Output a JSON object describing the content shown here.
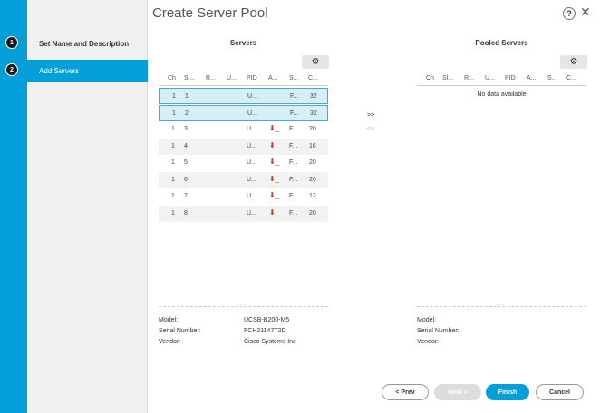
{
  "title": "Create Server Pool",
  "help_label": "?",
  "close_label": "✕",
  "steps": [
    {
      "num": "1",
      "label": "Set Name and Description"
    },
    {
      "num": "2",
      "label": "Add Servers"
    }
  ],
  "servers_panel": {
    "title": "Servers",
    "gear_icon": "⚙",
    "columns": [
      "Ch",
      "Sl...",
      "R...",
      "U...",
      "PID",
      "A...",
      "S...",
      "C..."
    ],
    "rows": [
      {
        "ch": "1",
        "slot": "1",
        "pid": "U...",
        "status": "",
        "s": "F...",
        "c": "32",
        "selected": true
      },
      {
        "ch": "1",
        "slot": "2",
        "pid": "U...",
        "status": "",
        "s": "F...",
        "c": "32",
        "selected": true
      },
      {
        "ch": "1",
        "slot": "3",
        "pid": "U...",
        "status": "⬇_",
        "s": "F...",
        "c": "20",
        "selected": false
      },
      {
        "ch": "1",
        "slot": "4",
        "pid": "U...",
        "status": "⬇_",
        "s": "F...",
        "c": "16",
        "selected": false
      },
      {
        "ch": "1",
        "slot": "5",
        "pid": "U...",
        "status": "⬇_",
        "s": "F...",
        "c": "20",
        "selected": false
      },
      {
        "ch": "1",
        "slot": "6",
        "pid": "U...",
        "status": "⬇_",
        "s": "F...",
        "c": "20",
        "selected": false
      },
      {
        "ch": "1",
        "slot": "7",
        "pid": "U...",
        "status": "⬇_",
        "s": "F...",
        "c": "12",
        "selected": false
      },
      {
        "ch": "1",
        "slot": "8",
        "pid": "U...",
        "status": "⬇_",
        "s": "F...",
        "c": "20",
        "selected": false
      }
    ]
  },
  "pooled_panel": {
    "title": "Pooled Servers",
    "gear_icon": "⚙",
    "columns": [
      "Ch",
      "Sl...",
      "R...",
      "U...",
      "PID",
      "A...",
      "S...",
      "C..."
    ],
    "empty_text": "No data available"
  },
  "move_right_label": ">>",
  "move_left_label": "<<",
  "splitter_dots": "....",
  "details_left": {
    "model_label": "Model:",
    "model_value": "UCSB-B200-M5",
    "serial_label": "Serial Number:",
    "serial_value": "FCH21147T2D",
    "vendor_label": "Vendor:",
    "vendor_value": "Cisco Systems Inc"
  },
  "details_right": {
    "model_label": "Model:",
    "serial_label": "Serial Number:",
    "vendor_label": "Vendor:"
  },
  "buttons": {
    "prev": "< Prev",
    "next": "Next >",
    "finish": "Finish",
    "cancel": "Cancel"
  },
  "colors": {
    "accent": "#049fd9",
    "selected_row": "#d6eef6",
    "status_arrow": "#c0392b"
  }
}
